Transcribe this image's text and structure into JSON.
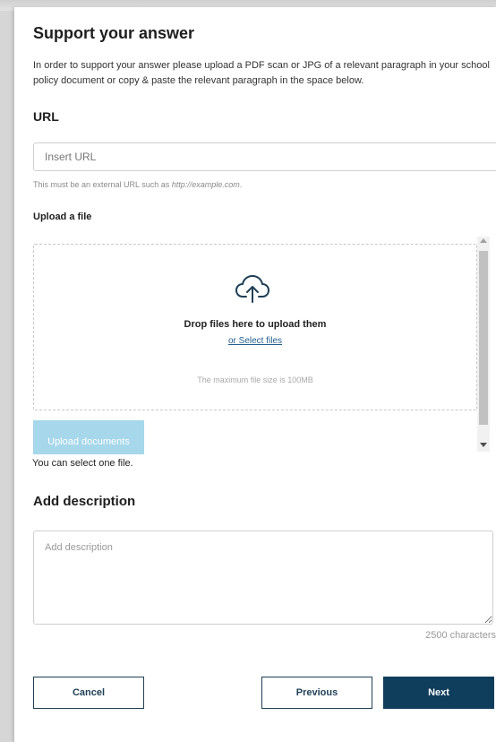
{
  "form": {
    "title": "Support your answer",
    "intro": "In order to support your answer please upload a PDF scan or JPG of a relevant paragraph in your school policy document or copy & paste the relevant paragraph in the space below."
  },
  "url_section": {
    "heading": "URL",
    "placeholder": "Insert URL",
    "value": "",
    "hint_prefix": "This must be an external URL such as ",
    "hint_example": "http://example.com",
    "hint_suffix": "."
  },
  "upload": {
    "label": "Upload a file",
    "icon": "cloud-upload-icon",
    "drop_title": "Drop files here to upload them",
    "select_link": "or Select files",
    "max_size": "The maximum file size is 100MB",
    "upload_button": "Upload documents",
    "limit_note": "You can select one file."
  },
  "description": {
    "heading": "Add description",
    "placeholder": "Add description",
    "value": "",
    "char_count": "2500 characters"
  },
  "actions": {
    "cancel": "Cancel",
    "previous": "Previous",
    "next": "Next"
  },
  "colors": {
    "primary": "#0f3d5c",
    "upload_disabled": "#a6d7ea",
    "link": "#1f5d8f"
  }
}
